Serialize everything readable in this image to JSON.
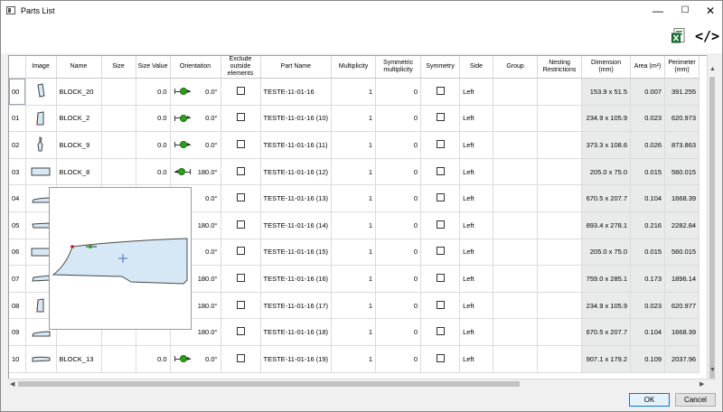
{
  "window": {
    "title": "Parts List",
    "minimize": "—",
    "maximize": "☐",
    "close": "✕"
  },
  "toolbar": {
    "export_code": "</>"
  },
  "columns": [
    "Image",
    "Name",
    "Size",
    "Size Value",
    "Orientation",
    "Exclude outside elements",
    "Part Name",
    "Multiplicity",
    "Symmetric multiplicity",
    "Symmetry",
    "Side",
    "Group",
    "Nesting Restrictions",
    "Dimension (mm)",
    "Area (m²)",
    "Perimeter (mm)"
  ],
  "rows": [
    {
      "idx": "00",
      "name": "BLOCK_20",
      "size_value": "0.0",
      "orientation": "0.0°",
      "dir": "r",
      "part_name": "TESTE-11-01-16",
      "mult": "1",
      "sym_mult": "0",
      "side": "Left",
      "dimension": "153.9 x 51.5",
      "area": "0.007",
      "perimeter": "391.255"
    },
    {
      "idx": "01",
      "name": "BLOCK_2",
      "size_value": "0.0",
      "orientation": "0.0°",
      "dir": "r",
      "part_name": "TESTE-11-01-16 (10)",
      "mult": "1",
      "sym_mult": "0",
      "side": "Left",
      "dimension": "234.9 x 105.9",
      "area": "0.023",
      "perimeter": "620.973"
    },
    {
      "idx": "02",
      "name": "BLOCK_9",
      "size_value": "0.0",
      "orientation": "0.0°",
      "dir": "r",
      "part_name": "TESTE-11-01-16 (11)",
      "mult": "1",
      "sym_mult": "0",
      "side": "Left",
      "dimension": "373.3 x 108.6",
      "area": "0.026",
      "perimeter": "873.863"
    },
    {
      "idx": "03",
      "name": "BLOCK_8",
      "size_value": "0.0",
      "orientation": "180.0°",
      "dir": "l",
      "part_name": "TESTE-11-01-16 (12)",
      "mult": "1",
      "sym_mult": "0",
      "side": "Left",
      "dimension": "205.0 x 75.0",
      "area": "0.015",
      "perimeter": "560.015"
    },
    {
      "idx": "04",
      "name": "",
      "size_value": "",
      "orientation": "0.0°",
      "dir": "",
      "part_name": "TESTE-11-01-16 (13)",
      "mult": "1",
      "sym_mult": "0",
      "side": "Left",
      "dimension": "670.5 x 207.7",
      "area": "0.104",
      "perimeter": "1668.39"
    },
    {
      "idx": "05",
      "name": "",
      "size_value": "",
      "orientation": "180.0°",
      "dir": "",
      "part_name": "TESTE-11-01-16 (14)",
      "mult": "1",
      "sym_mult": "0",
      "side": "Left",
      "dimension": "893.4 x 278.1",
      "area": "0.216",
      "perimeter": "2282.84"
    },
    {
      "idx": "06",
      "name": "",
      "size_value": "",
      "orientation": "0.0°",
      "dir": "",
      "part_name": "TESTE-11-01-16 (15)",
      "mult": "1",
      "sym_mult": "0",
      "side": "Left",
      "dimension": "205.0 x 75.0",
      "area": "0.015",
      "perimeter": "560.015"
    },
    {
      "idx": "07",
      "name": "",
      "size_value": "",
      "orientation": "180.0°",
      "dir": "",
      "part_name": "TESTE-11-01-16 (16)",
      "mult": "1",
      "sym_mult": "0",
      "side": "Left",
      "dimension": "759.0 x 285.1",
      "area": "0.173",
      "perimeter": "1896.14"
    },
    {
      "idx": "08",
      "name": "",
      "size_value": "",
      "orientation": "180.0°",
      "dir": "",
      "part_name": "TESTE-11-01-16 (17)",
      "mult": "1",
      "sym_mult": "0",
      "side": "Left",
      "dimension": "234.9 x 105.9",
      "area": "0.023",
      "perimeter": "620.977"
    },
    {
      "idx": "09",
      "name": "",
      "size_value": "",
      "orientation": "180.0°",
      "dir": "",
      "part_name": "TESTE-11-01-16 (18)",
      "mult": "1",
      "sym_mult": "0",
      "side": "Left",
      "dimension": "670.5 x 207.7",
      "area": "0.104",
      "perimeter": "1668.39"
    },
    {
      "idx": "10",
      "name": "BLOCK_13",
      "size_value": "0.0",
      "orientation": "0.0°",
      "dir": "r",
      "part_name": "TESTE-11-01-16 (19)",
      "mult": "1",
      "sym_mult": "0",
      "side": "Left",
      "dimension": "907.1 x 179.2",
      "area": "0.109",
      "perimeter": "2037.96"
    }
  ],
  "buttons": {
    "ok": "OK",
    "cancel": "Cancel"
  },
  "colors": {
    "accent": "#0078d7",
    "orientation_dot": "#2ca01c",
    "part_fill": "#d6e8f5",
    "dimension_bg": "#e9eaea"
  }
}
